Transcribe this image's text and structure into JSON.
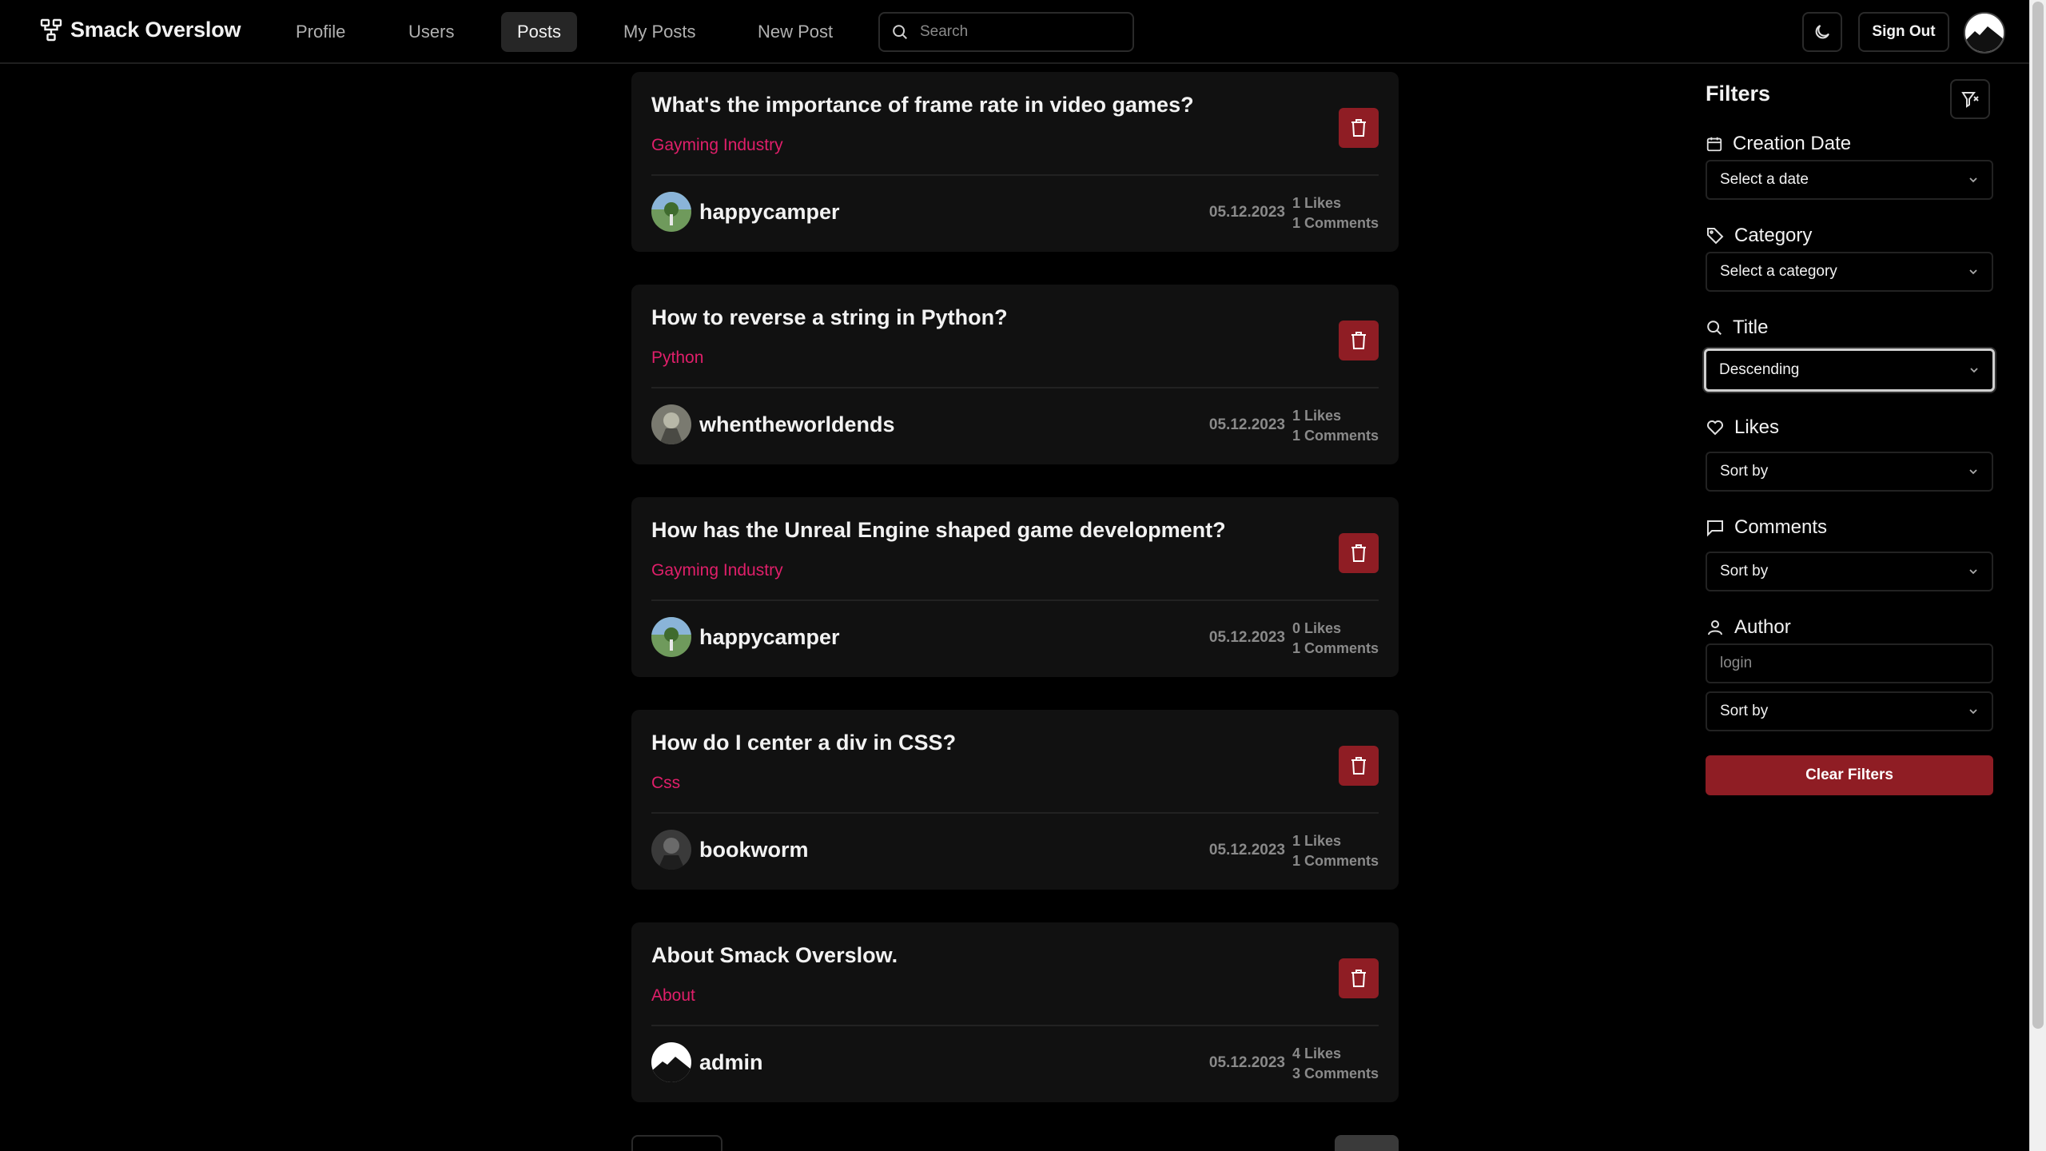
{
  "header": {
    "app_name": "Smack Overslow",
    "nav": [
      {
        "label": "Profile",
        "active": false
      },
      {
        "label": "Users",
        "active": false
      },
      {
        "label": "Posts",
        "active": true
      },
      {
        "label": "My Posts",
        "active": false
      },
      {
        "label": "New Post",
        "active": false
      }
    ],
    "search_placeholder": "Search",
    "sign_out_label": "Sign Out"
  },
  "posts": [
    {
      "title": "What's the importance of frame rate in video games?",
      "category": "Gayming Industry",
      "author": "happycamper",
      "date": "05.12.2023",
      "likes": "1 Likes",
      "comments": "1 Comments"
    },
    {
      "title": "How to reverse a string in Python?",
      "category": "Python",
      "author": "whentheworldends",
      "date": "05.12.2023",
      "likes": "1 Likes",
      "comments": "1 Comments"
    },
    {
      "title": "How has the Unreal Engine shaped game development?",
      "category": "Gayming Industry",
      "author": "happycamper",
      "date": "05.12.2023",
      "likes": "0 Likes",
      "comments": "1 Comments"
    },
    {
      "title": "How do I center a div in CSS?",
      "category": "Css",
      "author": "bookworm",
      "date": "05.12.2023",
      "likes": "1 Likes",
      "comments": "1 Comments"
    },
    {
      "title": "About Smack Overslow.",
      "category": "About",
      "author": "admin",
      "date": "05.12.2023",
      "likes": "4 Likes",
      "comments": "3 Comments"
    }
  ],
  "filters": {
    "title": "Filters",
    "creation_date": {
      "label": "Creation Date",
      "value": "Select a date"
    },
    "category": {
      "label": "Category",
      "value": "Select a category"
    },
    "title_sort": {
      "label": "Title",
      "value": "Descending"
    },
    "likes": {
      "label": "Likes",
      "value": "Sort by"
    },
    "comments": {
      "label": "Comments",
      "value": "Sort by"
    },
    "author": {
      "label": "Author",
      "placeholder": "login",
      "value": "Sort by"
    },
    "clear_label": "Clear Filters"
  },
  "colors": {
    "accent_danger": "#8f1d24",
    "category_text": "#e01f6a",
    "card_bg": "#111111",
    "page_bg": "#000000"
  }
}
